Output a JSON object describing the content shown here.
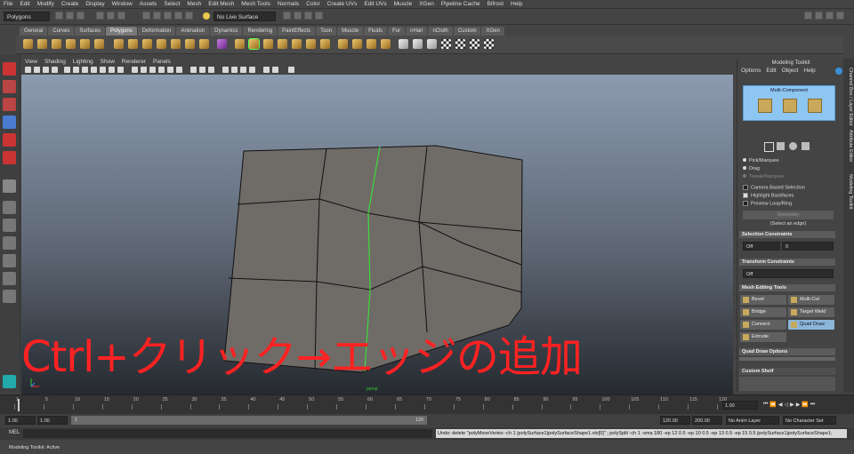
{
  "menubar": [
    "File",
    "Edit",
    "Modify",
    "Create",
    "Display",
    "Window",
    "Assets",
    "Select",
    "Mesh",
    "Edit Mesh",
    "Mesh Tools",
    "Normals",
    "Color",
    "Create UVs",
    "Edit UVs",
    "Muscle",
    "XGen",
    "Pipeline Cache",
    "Bifrost",
    "Help"
  ],
  "statusline": {
    "menuset": "Polygons",
    "live_surface": "No Live Surface"
  },
  "shelf_tabs": [
    "General",
    "Curves",
    "Surfaces",
    "Polygons",
    "Deformation",
    "Animation",
    "Dynamics",
    "Rendering",
    "PaintEffects",
    "Toon",
    "Muscle",
    "Fluids",
    "Fur",
    "nHair",
    "nCloth",
    "Custom",
    "XGen"
  ],
  "shelf_active_tab": "Polygons",
  "panel_menu": [
    "View",
    "Shading",
    "Lighting",
    "Show",
    "Renderer",
    "Panels"
  ],
  "viewport": {
    "camera_label": "persp",
    "caption": "Ctrl+クリック→エッジの追加"
  },
  "modeling_toolkit": {
    "title": "Modeling Toolkit",
    "menu": [
      "Options",
      "Edit",
      "Object",
      "Help"
    ],
    "mode_label": "Multi-Component",
    "pick_marquee": "Pick/Marquee",
    "drag": "Drag",
    "tweak_marquee": "Tweak/Marquee",
    "camera_based": "Camera Based Selection",
    "highlight_backfaces": "Highlight Backfaces",
    "preview_loop": "Preview Loop/Ring",
    "symmetry": "Symmetry",
    "select_edge_hint": "(Select an edge)",
    "selection_constraints": "Selection Constraints",
    "sc_off": "Off",
    "sc_value": "0",
    "transform_constraints": "Transform Constraints",
    "tc_off": "Off",
    "mesh_editing_tools": "Mesh Editing Tools",
    "tools": {
      "bevel": "Bevel",
      "multicut": "Multi-Cut",
      "bridge": "Bridge",
      "target_weld": "Target Weld",
      "connect": "Connect",
      "quad_draw": "Quad Draw",
      "extrude": "Extrude"
    },
    "quad_draw_options": "Quad Draw Options",
    "custom_shelf": "Custom Shelf"
  },
  "side_tabs": [
    "Channel Box / Layer Editor",
    "Attribute Editor",
    "Modeling Toolkit"
  ],
  "timeslider": {
    "ticks": [
      "1",
      "5",
      "10",
      "15",
      "20",
      "25",
      "30",
      "35",
      "40",
      "45",
      "50",
      "55",
      "60",
      "65",
      "70",
      "75",
      "80",
      "85",
      "90",
      "95",
      "100",
      "105",
      "110",
      "115",
      "120"
    ],
    "current_frame": "1.00"
  },
  "range": {
    "start": "1.00",
    "start2": "1.00",
    "frame": "1",
    "end_marker": "120",
    "end": "120.00",
    "end2": "200.00",
    "anim_layer": "No Anim Layer",
    "char_set": "No Character Set"
  },
  "cmdline": {
    "label": "MEL",
    "result": "Undo: delete \"polyMoveVertex -ch 1 |polySurface1|polySurfaceShape1.vtx[0]\" ; polySplit -ch 1 -sma 180 -ep 12 0.5 -ep 10 0.5 -ep 13 0.5 -ep 15 0.5 |polySurface1|polySurfaceShape1;"
  },
  "helpline": "Modeling Toolkit: Active"
}
